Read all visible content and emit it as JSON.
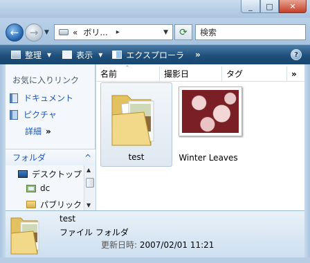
{
  "window": {
    "minimize_label": "_",
    "maximize_label": "□",
    "close_label": "✕"
  },
  "nav": {
    "back_glyph": "←",
    "forward_glyph": "→",
    "dropdown_glyph": "▼",
    "breadcrumb_prefix": "«",
    "breadcrumb": "ボリ...",
    "breadcrumb_sep": "▸",
    "address_dropdown": "▼",
    "refresh_glyph": "⟳"
  },
  "search": {
    "placeholder": "検索"
  },
  "toolbar": {
    "organize": "整理",
    "views": "表示",
    "explore": "エクスプローラ",
    "more": "»",
    "dropdown_arrow": "▼",
    "help": "?"
  },
  "sidebar": {
    "favorites_title": "お気に入りリンク",
    "favorites": [
      {
        "label": "ドキュメント",
        "icon": "documents-icon"
      },
      {
        "label": "ピクチャ",
        "icon": "pictures-icon"
      }
    ],
    "more_label": "詳細",
    "more_glyph": "»",
    "folders_title": "フォルダ",
    "folders_toggle": "^",
    "tree": [
      {
        "label": "デスクトップ",
        "icon": "desktop-icon"
      },
      {
        "label": "dc",
        "icon": "user-folder-icon"
      },
      {
        "label": "パブリック",
        "icon": "folder-icon"
      }
    ]
  },
  "columns": {
    "name": "名前",
    "date_taken": "撮影日",
    "tags": "タグ",
    "more": "»",
    "sort_indicator": "^"
  },
  "items": [
    {
      "label": "test",
      "type": "folder",
      "selected": true
    },
    {
      "label": "Winter Leaves",
      "type": "image",
      "selected": false
    }
  ],
  "details": {
    "name": "test",
    "type": "ファイル フォルダ",
    "modified_label": "更新日時:",
    "modified_value": "2007/02/01 11:21"
  },
  "colors": {
    "toolbar": "#1f4f7a",
    "link": "#1f55b4",
    "selection": "#dfe8f1"
  }
}
